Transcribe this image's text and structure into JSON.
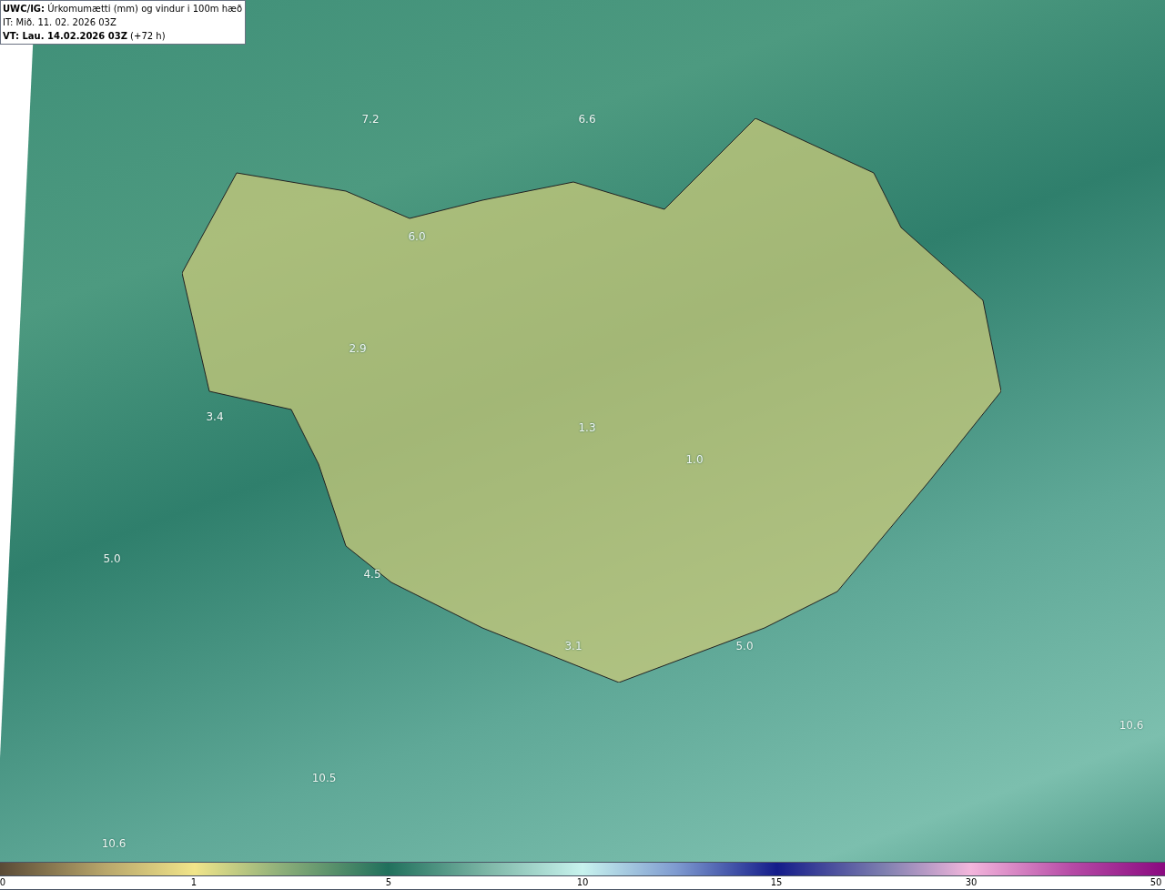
{
  "header": {
    "title": "**UWC/IG:** Úrkomumætti (mm) og vindur i 100m hæð",
    "issue_time": "IT: Mið. 11. 02. 2026 03Z",
    "valid_time": "**VT: Lau. 14.02.2026 03Z** (+72 h)"
  },
  "map_labels": [
    "7.2",
    "6.6",
    "6.0",
    "2.9",
    "3.4",
    "1.3",
    "1.0",
    "5.0",
    "4.5",
    "3.1",
    "5.0",
    "10.6",
    "10.5",
    "10.6"
  ],
  "colorbar": {
    "ticks": [
      "0",
      "1",
      "5",
      "10",
      "15",
      "30",
      "50"
    ]
  }
}
